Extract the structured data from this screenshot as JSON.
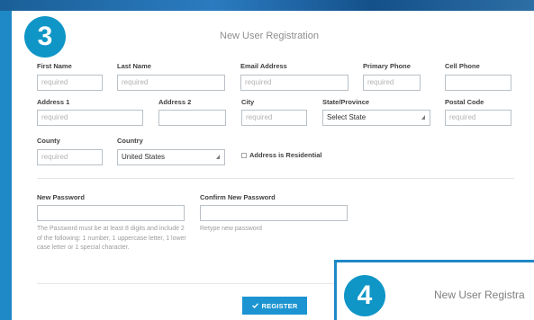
{
  "step3": {
    "badge": "3",
    "title": "New User Registration",
    "fields": {
      "first_name": {
        "label": "First Name",
        "placeholder": "required"
      },
      "last_name": {
        "label": "Last Name",
        "placeholder": "required"
      },
      "email": {
        "label": "Email Address",
        "placeholder": "required"
      },
      "primary_phone": {
        "label": "Primary Phone",
        "placeholder": "required"
      },
      "cell_phone": {
        "label": "Cell Phone",
        "placeholder": ""
      },
      "address1": {
        "label": "Address 1",
        "placeholder": "required"
      },
      "address2": {
        "label": "Address 2",
        "placeholder": ""
      },
      "city": {
        "label": "City",
        "placeholder": "required"
      },
      "state": {
        "label": "State/Province",
        "value": "Select State"
      },
      "postal": {
        "label": "Postal Code",
        "placeholder": "required"
      },
      "county": {
        "label": "County",
        "placeholder": "required"
      },
      "country": {
        "label": "Country",
        "value": "United States"
      },
      "residential": {
        "label": "Address is Residential"
      }
    },
    "password": {
      "label": "New Password",
      "help": "The Password must be at least 8 digits and include 2 of the following: 1 number, 1 uppercase letter, 1 lower case letter or 1 special character."
    },
    "confirm": {
      "label": "Confirm New Password",
      "help": "Retype new password"
    },
    "register_button": "REGISTER"
  },
  "step4": {
    "badge": "4",
    "title": "New User Registra"
  },
  "colors": {
    "accent": "#1b94d1",
    "badge": "#0f96c6",
    "frame": "#1f88c6"
  }
}
